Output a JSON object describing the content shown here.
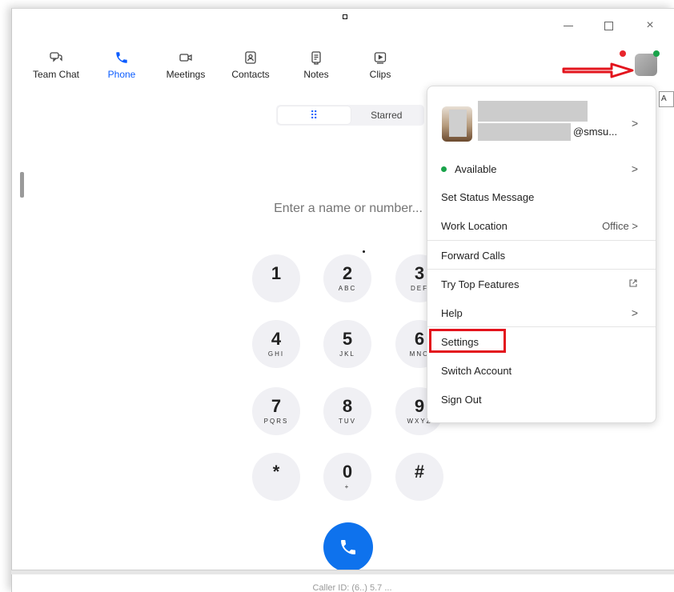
{
  "window": {
    "controls": {
      "minimize": "minimize",
      "maximize": "maximize",
      "close": "×"
    }
  },
  "nav": {
    "items": [
      {
        "label": "Team Chat",
        "icon": "chat-icon"
      },
      {
        "label": "Phone",
        "icon": "phone-icon",
        "active": true
      },
      {
        "label": "Meetings",
        "icon": "video-camera-icon"
      },
      {
        "label": "Contacts",
        "icon": "contacts-icon"
      },
      {
        "label": "Notes",
        "icon": "notes-icon"
      },
      {
        "label": "Clips",
        "icon": "clips-icon"
      }
    ]
  },
  "phone": {
    "tabs": {
      "keypad_icon": "⠿",
      "starred": "Starred"
    },
    "input_placeholder": "Enter a name or number...",
    "keys": [
      {
        "digit": "1",
        "letters": ""
      },
      {
        "digit": "2",
        "letters": "ABC"
      },
      {
        "digit": "3",
        "letters": "DEF"
      },
      {
        "digit": "4",
        "letters": "GHI"
      },
      {
        "digit": "5",
        "letters": "JKL"
      },
      {
        "digit": "6",
        "letters": "MNO"
      },
      {
        "digit": "7",
        "letters": "PQRS"
      },
      {
        "digit": "8",
        "letters": "TUV"
      },
      {
        "digit": "9",
        "letters": "WXYZ"
      },
      {
        "digit": "*",
        "letters": ""
      },
      {
        "digit": "0",
        "letters": "+"
      },
      {
        "digit": "#",
        "letters": ""
      }
    ],
    "caller_id_partial": "Caller ID: (6..) 5.7 ..."
  },
  "menu": {
    "email_domain": "@smsu...",
    "items": {
      "available": "Available",
      "set_status": "Set Status Message",
      "work_location": "Work Location",
      "work_location_value": "Office",
      "forward_calls": "Forward Calls",
      "try_top_features": "Try Top Features",
      "help": "Help",
      "settings": "Settings",
      "switch_account": "Switch Account",
      "sign_out": "Sign Out"
    },
    "chevron": ">"
  },
  "edge_tooltip": "A",
  "colors": {
    "accent": "#0b5cff",
    "call_button": "#0e72ed",
    "available_status": "#19a34a",
    "notification": "#e8262c",
    "highlight": "#e3141d"
  }
}
